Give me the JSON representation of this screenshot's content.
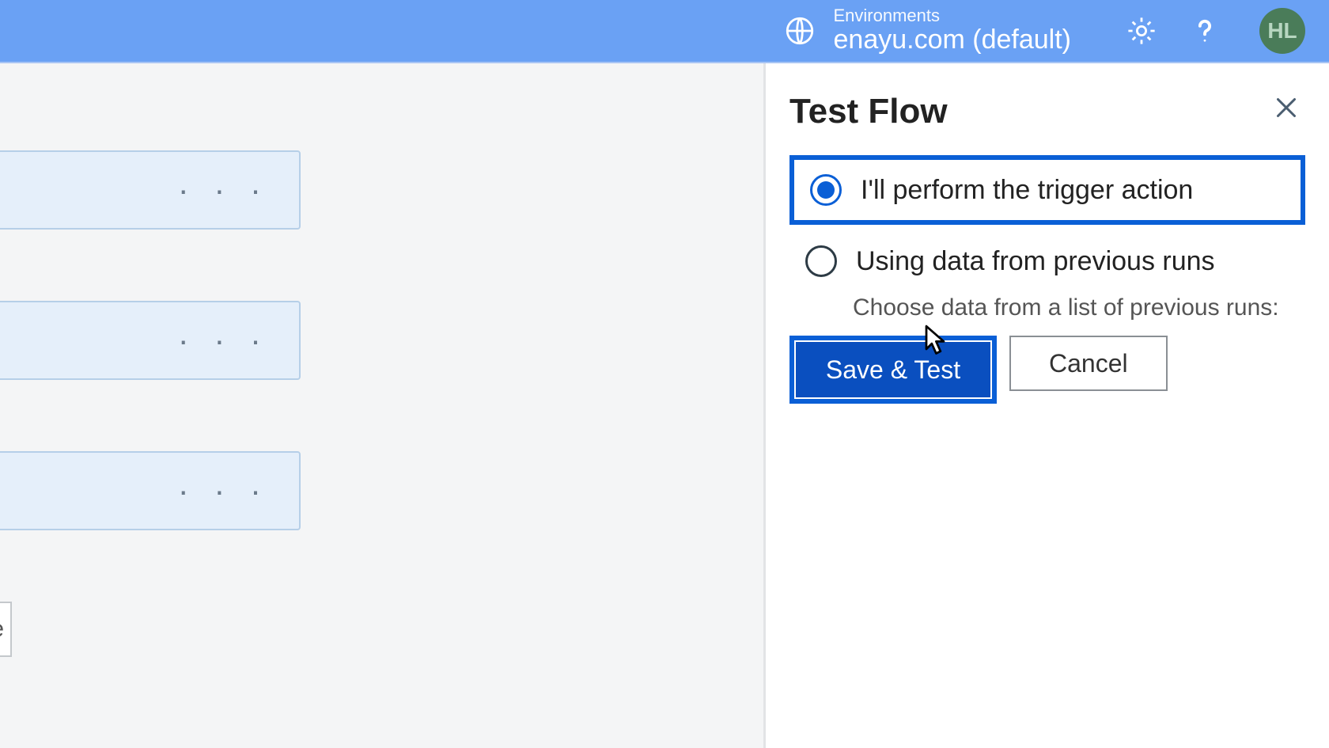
{
  "header": {
    "env_label": "Environments",
    "env_value": "enayu.com (default)",
    "avatar_initials": "HL"
  },
  "panel": {
    "title": "Test Flow",
    "option1_label": "I'll perform the trigger action",
    "option2_label": "Using data from previous runs",
    "option2_sub": "Choose data from a list of previous runs:",
    "save_test_label": "Save & Test",
    "cancel_label": "Cancel"
  },
  "canvas": {
    "small_card_text": "e"
  }
}
